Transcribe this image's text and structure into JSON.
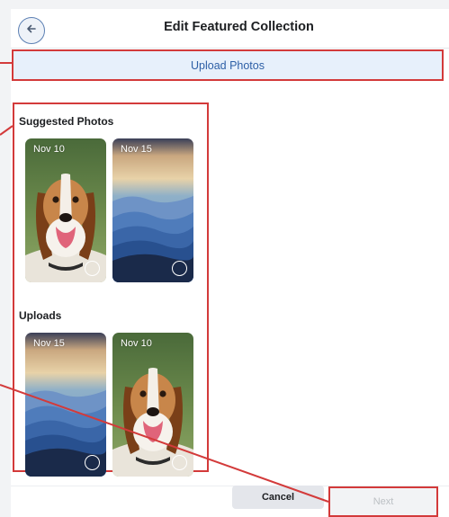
{
  "header": {
    "title": "Edit Featured Collection",
    "back_icon": "arrow-left-icon"
  },
  "upload": {
    "label": "Upload Photos"
  },
  "suggested": {
    "heading": "Suggested Photos",
    "items": [
      {
        "date": "Nov 10",
        "subject": "dog",
        "selected": false
      },
      {
        "date": "Nov 15",
        "subject": "mountains",
        "selected": false
      }
    ]
  },
  "uploads": {
    "heading": "Uploads",
    "items": [
      {
        "date": "Nov 15",
        "subject": "mountains",
        "selected": false
      },
      {
        "date": "Nov 10",
        "subject": "dog",
        "selected": false
      }
    ]
  },
  "footer": {
    "cancel_label": "Cancel",
    "next_label": "Next"
  },
  "colors": {
    "annotation": "#d33a3a",
    "link_blue": "#2d5fa6",
    "upload_bg": "#e7f0fb"
  }
}
